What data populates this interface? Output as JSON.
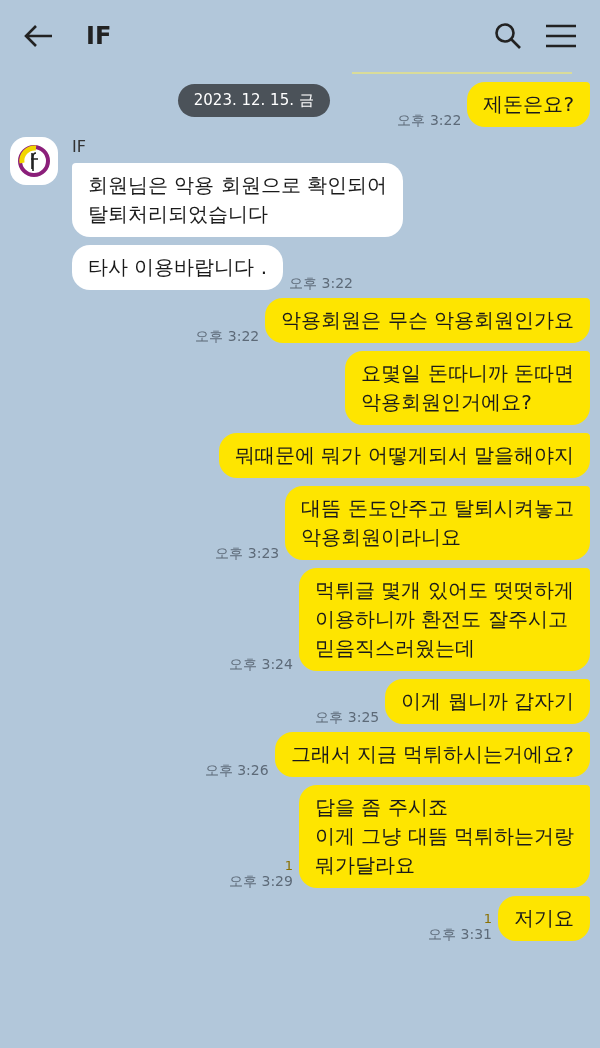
{
  "header": {
    "title": "IF"
  },
  "messages": [
    {
      "kind": "sent_with_date",
      "date": "2023. 12. 15. 금",
      "text": "제돈은요?",
      "time": "오후 3:22",
      "tail": true
    },
    {
      "kind": "received",
      "sender": "IF",
      "text": "회원님은 악용 회원으로 확인되어\n탈퇴처리되었습니다",
      "tail": true
    },
    {
      "kind": "received",
      "text": "타사 이용바랍니다 .",
      "time": "오후 3:22",
      "tail": false
    },
    {
      "kind": "sent",
      "text": "악용회원은 무슨 악용회원인가요",
      "time": "오후 3:22",
      "tail": true
    },
    {
      "kind": "sent",
      "text": "요몇일 돈따니까 돈따면\n악용회원인거에요?",
      "tail": true
    },
    {
      "kind": "sent",
      "text": "뭐때문에 뭐가 어떻게되서 말을해야지",
      "tail": true
    },
    {
      "kind": "sent",
      "text": "대뜸 돈도안주고 탈퇴시켜놓고\n악용회원이라니요",
      "time": "오후 3:23",
      "tail": true
    },
    {
      "kind": "sent",
      "text": "먹튀글 몇개 있어도 떳떳하게\n이용하니까 환전도 잘주시고\n믿음직스러웠는데",
      "time": "오후 3:24",
      "tail": true
    },
    {
      "kind": "sent",
      "text": "이게 뭡니까 갑자기",
      "time": "오후 3:25",
      "tail": true
    },
    {
      "kind": "sent",
      "text": "그래서 지금 먹튀하시는거에요?",
      "time": "오후 3:26",
      "tail": true
    },
    {
      "kind": "sent",
      "text": "답을 좀 주시죠\n이게 그냥 대뜸 먹튀하는거랑\n뭐가달라요",
      "unread": "1",
      "time": "오후 3:29",
      "tail": true
    },
    {
      "kind": "sent",
      "text": "저기요",
      "unread": "1",
      "time": "오후 3:31",
      "tail": true
    }
  ]
}
